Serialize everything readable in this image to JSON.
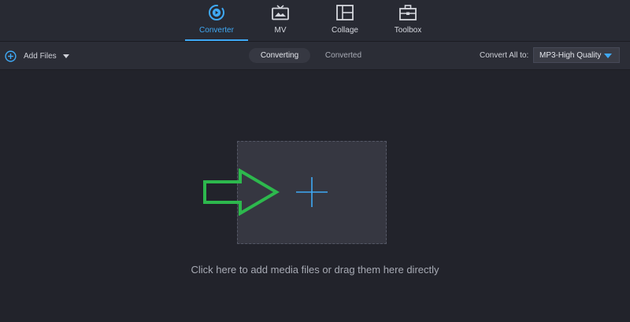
{
  "nav": {
    "tabs": [
      {
        "label": "Converter",
        "icon": "converter-icon",
        "active": true
      },
      {
        "label": "MV",
        "icon": "tv-icon",
        "active": false
      },
      {
        "label": "Collage",
        "icon": "collage-icon",
        "active": false
      },
      {
        "label": "Toolbox",
        "icon": "toolbox-icon",
        "active": false
      }
    ]
  },
  "toolbar": {
    "add_files_label": "Add Files",
    "segments": [
      "Converting",
      "Converted"
    ],
    "active_segment": "Converting",
    "convert_all_label": "Convert All to:",
    "format_selected": "MP3-High Quality"
  },
  "main": {
    "dropzone_hint": "Click here to add media files or drag them here directly"
  },
  "colors": {
    "accent": "#3fa9f5",
    "background": "#22232b",
    "annotation_arrow": "#2db84d"
  }
}
